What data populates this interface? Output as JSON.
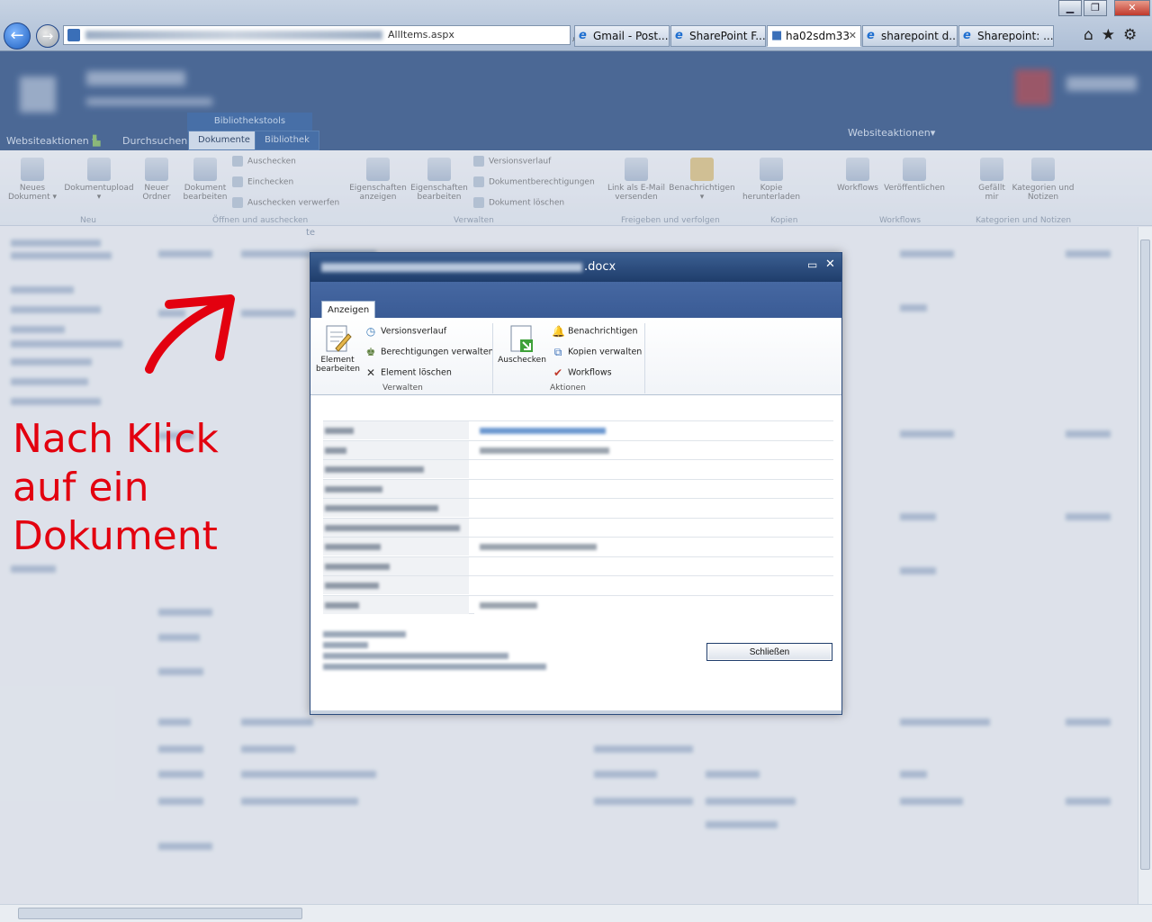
{
  "browser": {
    "address_suffix": "AllItems.aspx",
    "address_controls": "⌕ ▾ ↻ ✕",
    "tabs": [
      {
        "label": "Gmail - Post..."
      },
      {
        "label": "SharePoint F..."
      },
      {
        "label": "ha02sdm33"
      },
      {
        "label": "sharepoint d..."
      },
      {
        "label": "Sharepoint: ..."
      }
    ],
    "active_tab_close": "✕",
    "window_controls": {
      "minimize": "▁",
      "maximize": "❐",
      "close": "✕"
    },
    "back_glyph": "←",
    "forward_glyph": "→",
    "toolbar_icons": "⌂★⚙"
  },
  "sharepoint": {
    "ribbon_tabs": {
      "websiteaktionen": "Websiteaktionen ▾",
      "durchsuchen": "Durchsuchen",
      "context_group": "Bibliothekstools",
      "dokumente": "Dokumente",
      "bibliothek": "Bibliothek",
      "websiteaktionen_right": "Websiteaktionen▾"
    },
    "ribbon": {
      "neues_dokument": "Neues Dokument ▾",
      "dokumentupload": "Dokumentupload ▾",
      "neuer_ordner": "Neuer Ordner",
      "dokument_bearbeiten": "Dokument bearbeiten",
      "auschecken": "Auschecken",
      "einchecken": "Einchecken",
      "auschecken_verwerfen": "Auschecken verwerfen",
      "eigenschaften_anzeigen": "Eigenschaften anzeigen",
      "eigenschaften_bearbeiten": "Eigenschaften bearbeiten",
      "versionsverlauf": "Versionsverlauf",
      "dokumentberechtigungen": "Dokumentberechtigungen",
      "dokument_loeschen": "Dokument löschen",
      "link_email": "Link als E-Mail versenden",
      "benachrichtigen": "Benachrichtigen ▾",
      "kopie_herunterladen": "Kopie herunterladen",
      "workflows": "Workflows",
      "veroeffentlichen": "Veröffentlichen",
      "gefaellt_mir": "Gefällt mir",
      "kategorien_notizen": "Kategorien und Notizen",
      "groups": {
        "neu": "Neu",
        "oeffnen": "Öffnen und auschecken",
        "verwalten": "Verwalten",
        "freigeben": "Freigeben und verfolgen",
        "kopien": "Kopien",
        "workflows": "Workflows",
        "kategorien": "Kategorien und Notizen"
      }
    },
    "column_fragment": "te"
  },
  "annotation": {
    "line1": "Nach Klick",
    "line2": "auf ein",
    "line3": "Dokument",
    "color": "#e3000f"
  },
  "dialog": {
    "title_suffix": ".docx",
    "maximize_glyph": "▭",
    "close_glyph": "✕",
    "tab": "Anzeigen",
    "element_bearbeiten": "Element bearbeiten",
    "versionsverlauf": "Versionsverlauf",
    "berechtigungen_verwalten": "Berechtigungen verwalten",
    "element_loeschen": "Element löschen",
    "group_verwalten": "Verwalten",
    "auschecken": "Auschecken",
    "benachrichtigen": "Benachrichtigen",
    "kopien_verwalten": "Kopien verwalten",
    "workflows": "Workflows",
    "group_aktionen": "Aktionen",
    "close_button": "Schließen"
  },
  "colors": {
    "sharepoint_blue": "#21477f",
    "dialog_title": "#1f3d6b",
    "annotation_red": "#e3000f"
  }
}
